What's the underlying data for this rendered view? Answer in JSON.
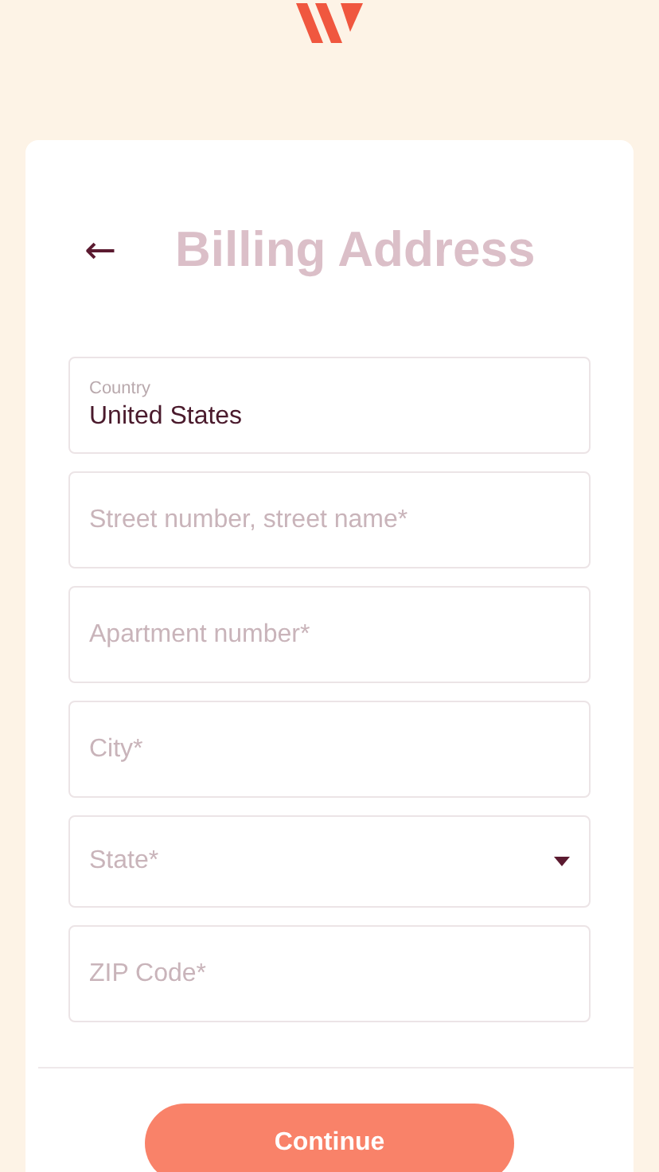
{
  "header": {
    "back": "←",
    "title": "Billing Address"
  },
  "fields": [
    {
      "kind": "filled",
      "label": "Country",
      "value": "United States"
    },
    {
      "kind": "text",
      "placeholder": "Street number, street name*"
    },
    {
      "kind": "text",
      "placeholder": "Apartment number*"
    },
    {
      "kind": "text",
      "placeholder": "City*"
    },
    {
      "kind": "select",
      "placeholder": "State*"
    },
    {
      "kind": "text",
      "placeholder": "ZIP Code*"
    }
  ],
  "button": "Continue"
}
